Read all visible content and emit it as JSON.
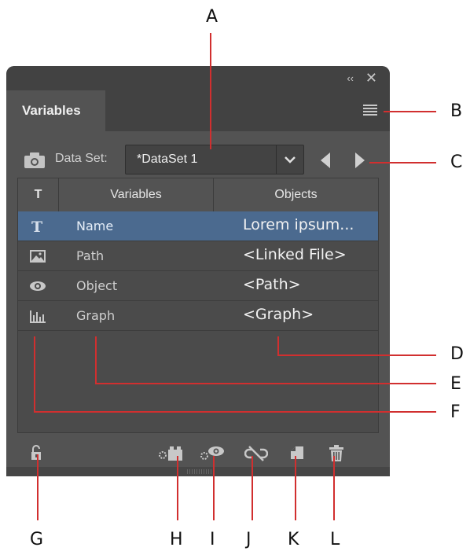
{
  "callouts": [
    "A",
    "B",
    "C",
    "D",
    "E",
    "F",
    "G",
    "H",
    "I",
    "J",
    "K",
    "L"
  ],
  "panel": {
    "collapse_glyph": "‹‹",
    "close_glyph": "✕",
    "tab_label": "Variables",
    "dataset": {
      "label": "Data Set:",
      "value": "*DataSet 1"
    },
    "table": {
      "headers": {
        "type": "T",
        "variables": "Variables",
        "objects": "Objects"
      },
      "rows": [
        {
          "type_icon": "text-variable-icon",
          "name": "Name",
          "object": "Lorem ipsum...",
          "selected": true
        },
        {
          "type_icon": "linked-file-variable-icon",
          "name": "Path",
          "object": "<Linked File>",
          "selected": false
        },
        {
          "type_icon": "visibility-variable-icon",
          "name": "Object",
          "object": "<Path>",
          "selected": false
        },
        {
          "type_icon": "graph-variable-icon",
          "name": "Graph",
          "object": "<Graph>",
          "selected": false
        }
      ]
    },
    "footer_icons": [
      "lock-icon",
      "make-dynamic-icon",
      "make-visibility-dynamic-icon",
      "unbind-icon",
      "new-variable-icon",
      "delete-icon"
    ]
  },
  "colors": {
    "panel_bg": "#535353",
    "header_bg": "#424242",
    "selection": "#4b6a8f",
    "callout_line": "#d12f2f"
  }
}
